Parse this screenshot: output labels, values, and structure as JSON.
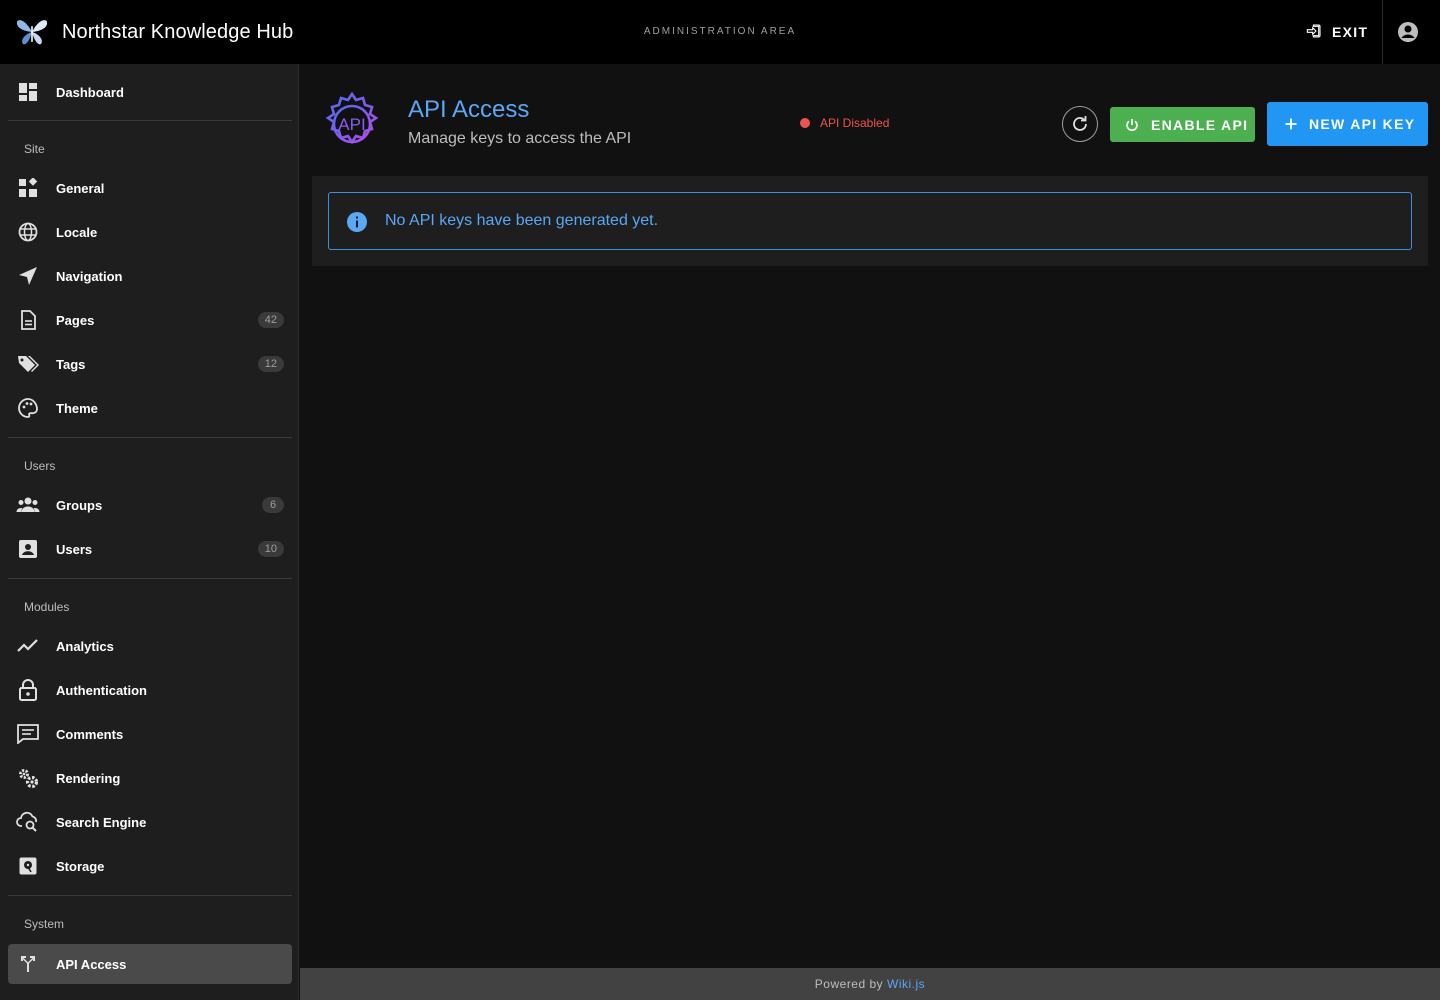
{
  "header": {
    "app_title": "Northstar Knowledge Hub",
    "area_label": "ADMINISTRATION AREA",
    "exit_label": "EXIT",
    "logo_icon": "butterfly-logo",
    "account_icon": "account-circle-icon"
  },
  "sidebar": {
    "dashboard": {
      "label": "Dashboard",
      "icon": "dashboard-icon"
    },
    "sections": {
      "site": "Site",
      "users": "Users",
      "modules": "Modules",
      "system": "System"
    },
    "site_items": [
      {
        "label": "General",
        "icon": "widgets-icon"
      },
      {
        "label": "Locale",
        "icon": "globe-icon"
      },
      {
        "label": "Navigation",
        "icon": "navigation-arrow-icon"
      },
      {
        "label": "Pages",
        "icon": "file-document-icon",
        "count": "42"
      },
      {
        "label": "Tags",
        "icon": "tags-icon",
        "count": "12"
      },
      {
        "label": "Theme",
        "icon": "palette-icon"
      }
    ],
    "user_items": [
      {
        "label": "Groups",
        "icon": "groups-icon",
        "count": "6"
      },
      {
        "label": "Users",
        "icon": "account-box-icon",
        "count": "10"
      }
    ],
    "module_items": [
      {
        "label": "Analytics",
        "icon": "chart-line-icon"
      },
      {
        "label": "Authentication",
        "icon": "lock-icon"
      },
      {
        "label": "Comments",
        "icon": "comment-icon"
      },
      {
        "label": "Rendering",
        "icon": "cogs-icon"
      },
      {
        "label": "Search Engine",
        "icon": "cloud-search-icon"
      },
      {
        "label": "Storage",
        "icon": "harddisk-icon"
      }
    ],
    "system_items": [
      {
        "label": "API Access",
        "icon": "api-fork-icon",
        "active": true
      }
    ]
  },
  "main": {
    "title": "API Access",
    "subtitle": "Manage keys to access the API",
    "status_text": "API Disabled",
    "status_color": "#ef5350",
    "enable_label": "ENABLE API",
    "new_key_label": "NEW API KEY",
    "alert_message": "No API keys have been generated yet."
  },
  "footer": {
    "prefix": "Powered by",
    "link": "Wiki.js"
  },
  "colors": {
    "accent": "#2196f3",
    "title_blue": "#5aa7f5",
    "enable_green": "#4caf50"
  }
}
